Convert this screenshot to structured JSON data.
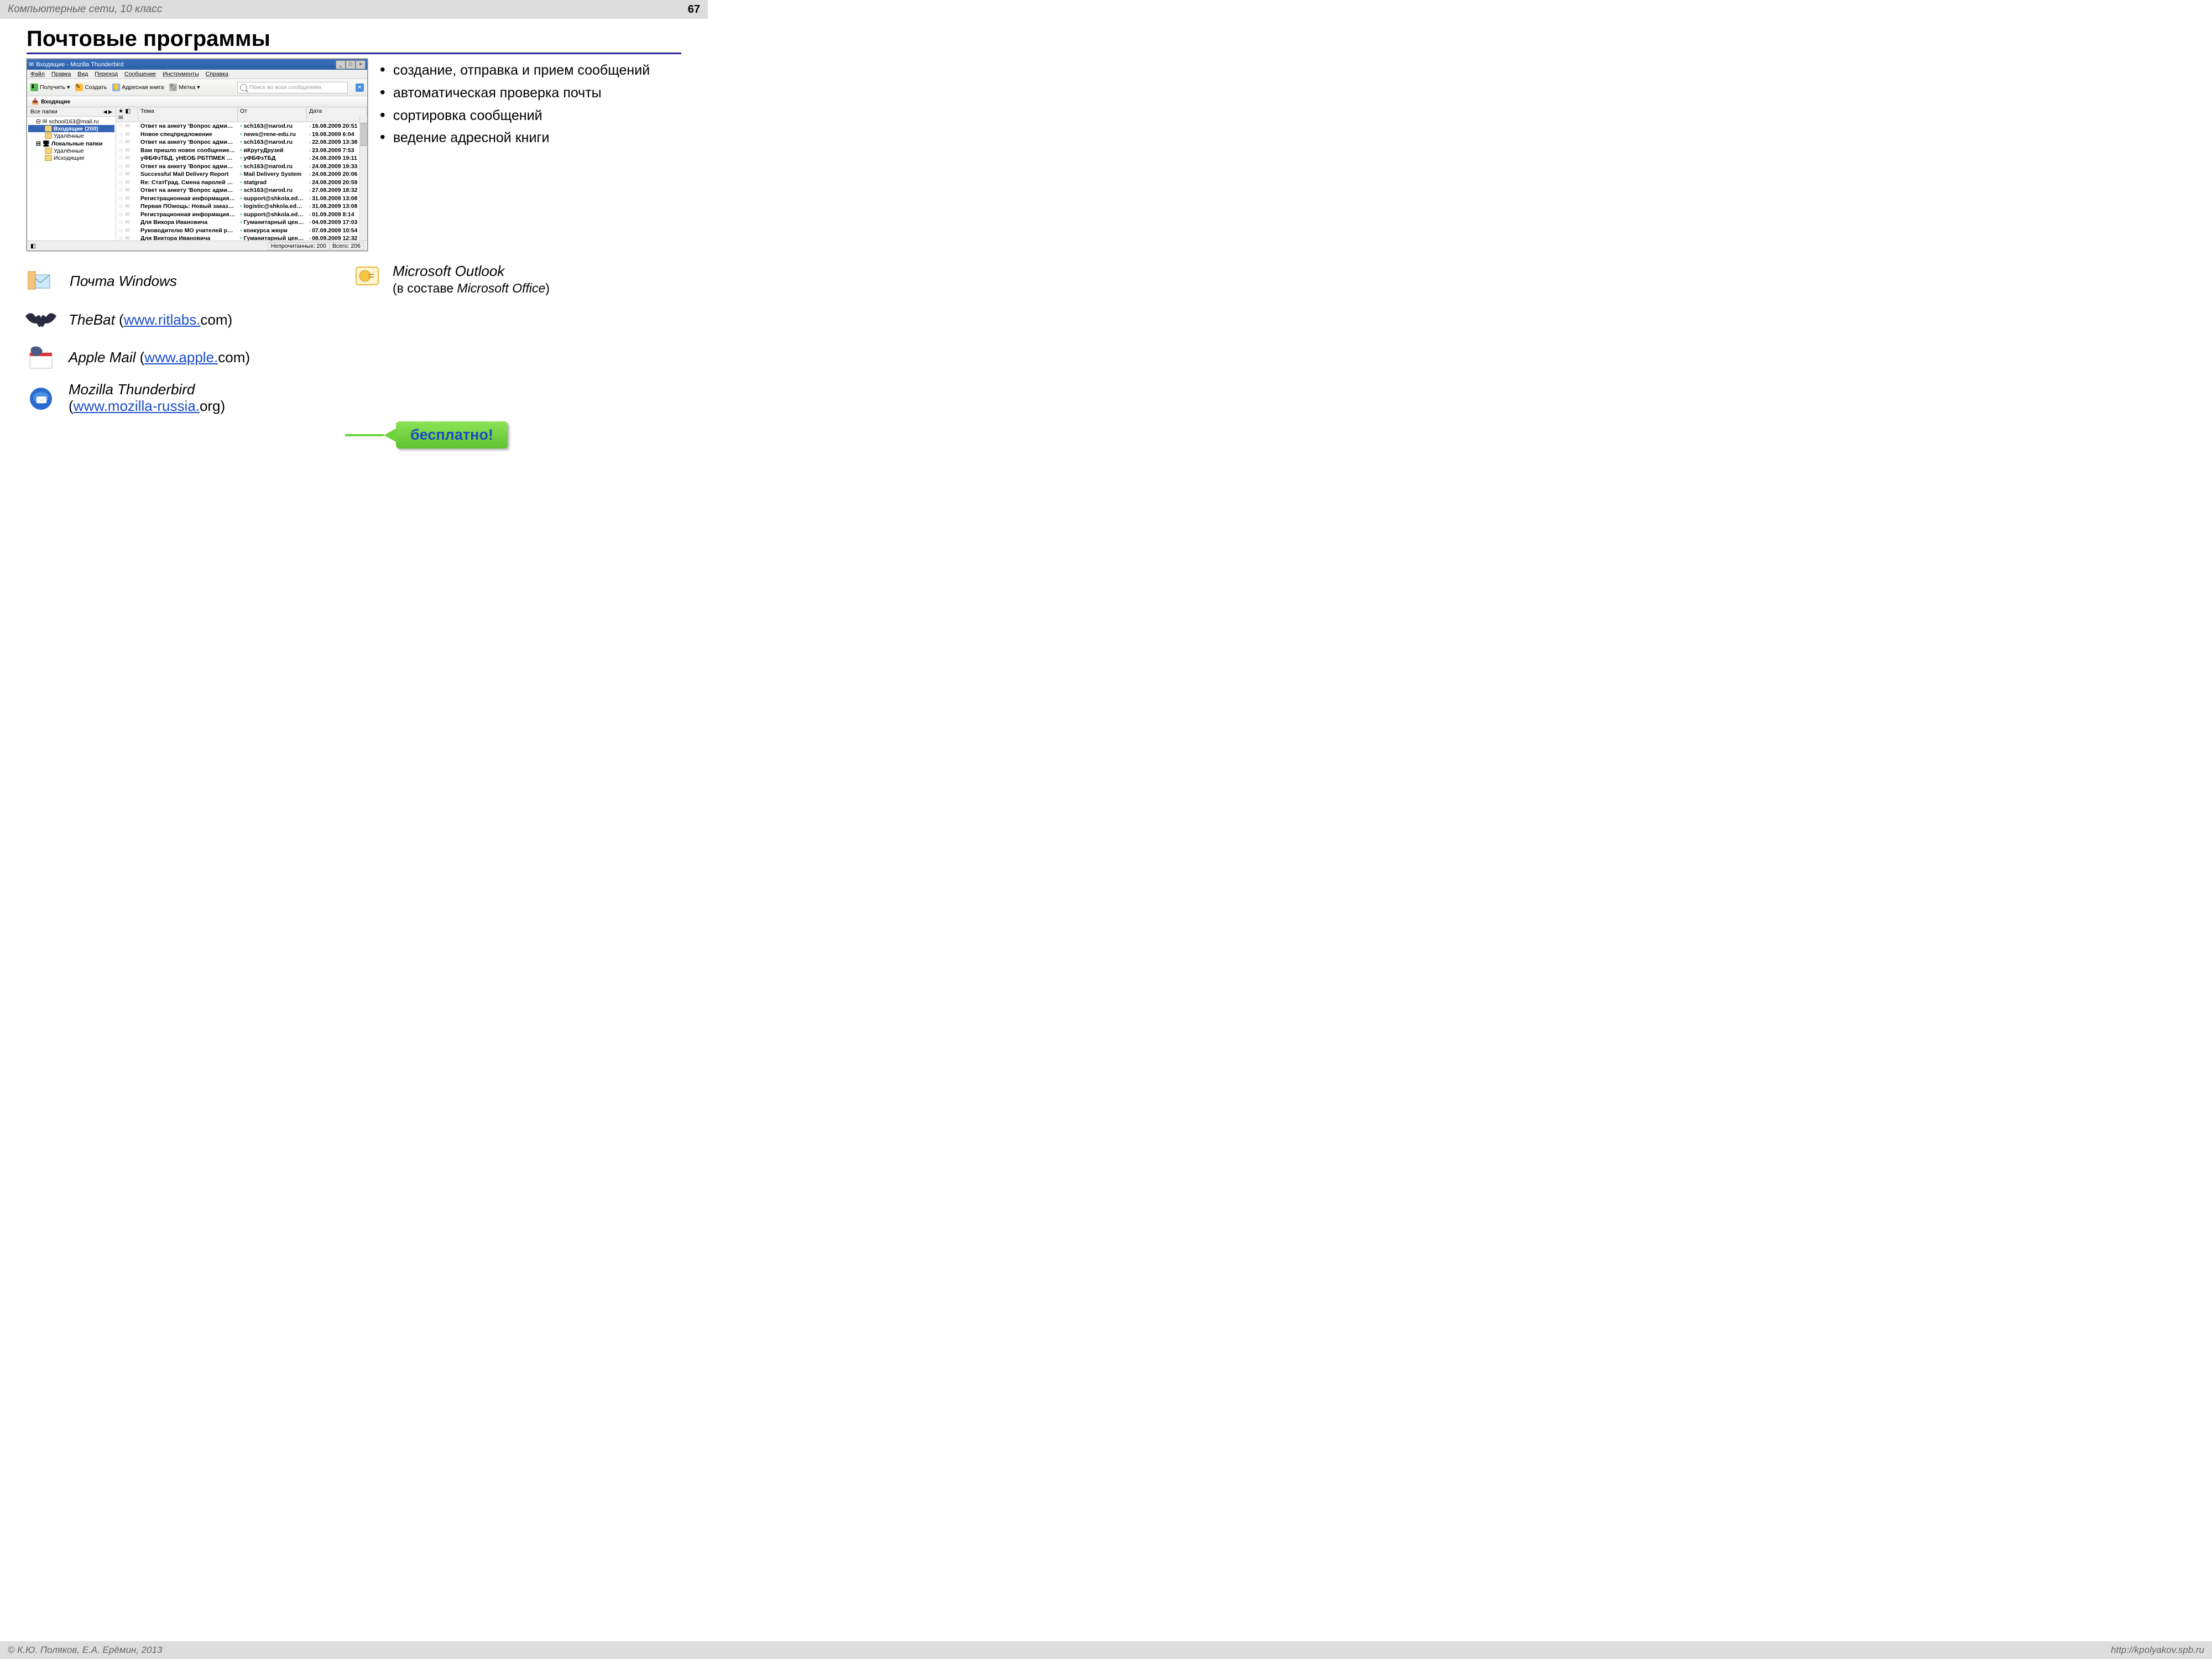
{
  "header": {
    "subject": "Компьютерные сети, 10 класс",
    "page": "67"
  },
  "title": "Почтовые программы",
  "bullets": [
    "создание, отправка и прием сообщений",
    "автоматическая проверка почты",
    "сортировка сообщений",
    "ведение адресной книги"
  ],
  "thunderbird": {
    "window_title": "Входящие - Mozilla Thunderbird",
    "menu": [
      "Файл",
      "Правка",
      "Вид",
      "Переход",
      "Сообщение",
      "Инструменты",
      "Справка"
    ],
    "toolbar": {
      "receive": "Получить",
      "compose": "Создать",
      "addressbook": "Адресная книга",
      "tag": "Метка",
      "search_placeholder": "Поиск во всех сообщениях"
    },
    "tab": "Входящие",
    "folders": {
      "header": "Все папки",
      "account": "school163@mail.ru",
      "inbox": "Входящие (200)",
      "trash1": "Удалённые",
      "local": "Локальные папки",
      "trash2": "Удалённые",
      "outbox": "Исходящие"
    },
    "columns": {
      "subject": "Тема",
      "from": "От",
      "date": "Дата"
    },
    "rows": [
      {
        "s": "Ответ на анкету 'Вопрос админи…",
        "f": "sch163@narod.ru",
        "d": "16.08.2009 20:51"
      },
      {
        "s": "Новое спецпредложение",
        "f": "news@rene-edu.ru",
        "d": "19.08.2009 6:04"
      },
      {
        "s": "Ответ на анкету 'Вопрос админи…",
        "f": "sch163@narod.ru",
        "d": "22.08.2009 13:38"
      },
      {
        "s": "Вам пришло новое сообщение на …",
        "f": "вКругуДрузей",
        "d": "23.08.2009 7:53"
      },
      {
        "s": "уФБФзТБД. уНЕОБ РБТПМЕК 01.09…",
        "f": "уФБФзТБД",
        "d": "24.08.2009 19:11"
      },
      {
        "s": "Ответ на анкету 'Вопрос админи…",
        "f": "sch163@narod.ru",
        "d": "24.08.2009 19:33"
      },
      {
        "s": "Successful Mail Delivery Report",
        "f": "Mail Delivery System",
        "d": "24.08.2009 20:06"
      },
      {
        "s": "Re: СтатГрад. Смена паролей 01.…",
        "f": "statgrad",
        "d": "24.08.2009 20:59"
      },
      {
        "s": "Ответ на анкету 'Вопрос админи…",
        "f": "sch163@narod.ru",
        "d": "27.08.2009 18:32"
      },
      {
        "s": "Регистрационная информация по…",
        "f": "support@shkola.edu.ru",
        "d": "31.08.2009 13:08"
      },
      {
        "s": "Первая ПОмощь: Новый заказ N1…",
        "f": "logistic@shkola.edu.ru",
        "d": "31.08.2009 13:08"
      },
      {
        "s": "Регистрационная информация по…",
        "f": "support@shkola.edu.ru",
        "d": "01.09.2009 8:14"
      },
      {
        "s": "Для Викора Ивановича",
        "f": "Гуманитарный цент…",
        "d": "04.09.2009 17:03"
      },
      {
        "s": "Руководителю МО учителей рус…",
        "f": "конкурса жюри",
        "d": "07.09.2009 10:54"
      },
      {
        "s": "Для Виктора Ивановича",
        "f": "Гуманитарный цент…",
        "d": "08.09.2009 12:32"
      }
    ],
    "status": {
      "unread": "Непрочитанных: 200",
      "total": "Всего: 206"
    }
  },
  "clients": {
    "windows_mail": "Почта Windows",
    "thebat": {
      "name": "TheBat",
      "link_text": "www.ritlabs.",
      "link_suffix": "com"
    },
    "apple": {
      "name": "Apple Mail",
      "link_text": "www.apple.",
      "link_suffix": "com"
    },
    "tb": {
      "name": "Mozilla Thunderbird",
      "link_text": "www.mozilla-russia.",
      "link_suffix": "org"
    },
    "outlook": {
      "name": "Microsoft Outlook",
      "sub_prefix": "(в составе ",
      "sub_italic": "Microsoft Office",
      "sub_suffix": ")"
    }
  },
  "callout": "бесплатно!",
  "footer": {
    "left": "© К.Ю. Поляков, Е.А. Ерёмин, 2013",
    "right": "http://kpolyakov.spb.ru"
  }
}
